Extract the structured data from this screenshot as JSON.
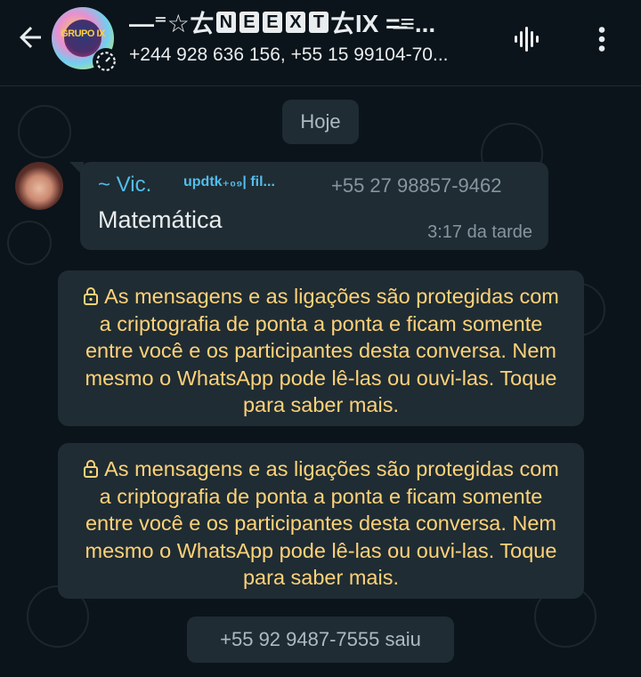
{
  "header": {
    "title_parts": [
      "—⁼☆ㄊ",
      "N",
      "E",
      "E",
      "X",
      "T",
      "ㄊIX =̶≡..."
    ],
    "participants": "+244 928 636 156, +55 15 99104-70...",
    "avatar_label": "GRUPO IX"
  },
  "chat": {
    "date_chip": "Hoje",
    "message": {
      "sender_name": "~ Vic.",
      "sender_tag": "updtk₊₀₉| fil...",
      "sender_phone": "+55 27 98857-9462",
      "text": "Matemática",
      "time": "3:17 da tarde"
    },
    "encryption_notices": [
      "As mensagens e as ligações são protegidas com a criptografia de ponta a ponta e ficam somente entre você e os participantes desta conversa. Nem mesmo o WhatsApp pode lê-las ou ouvi-las. Toque para saber mais.",
      "As mensagens e as ligações são protegidas com a criptografia de ponta a ponta e ficam somente entre você e os participantes desta conversa. Nem mesmo o WhatsApp pode lê-las ou ouvi-las. Toque para saber mais."
    ],
    "leave_notice": "+55 92 9487-7555 saiu"
  },
  "icons": {
    "back": "back-arrow-icon",
    "voice_chat": "voice-chat-icon",
    "menu": "more-vertical-icon",
    "lock": "lock-icon"
  },
  "colors": {
    "background": "#0b141a",
    "bubble": "#1f2c33",
    "notice_text": "#ffd279",
    "sender_accent": "#53bdeb",
    "muted": "#8696a0"
  }
}
